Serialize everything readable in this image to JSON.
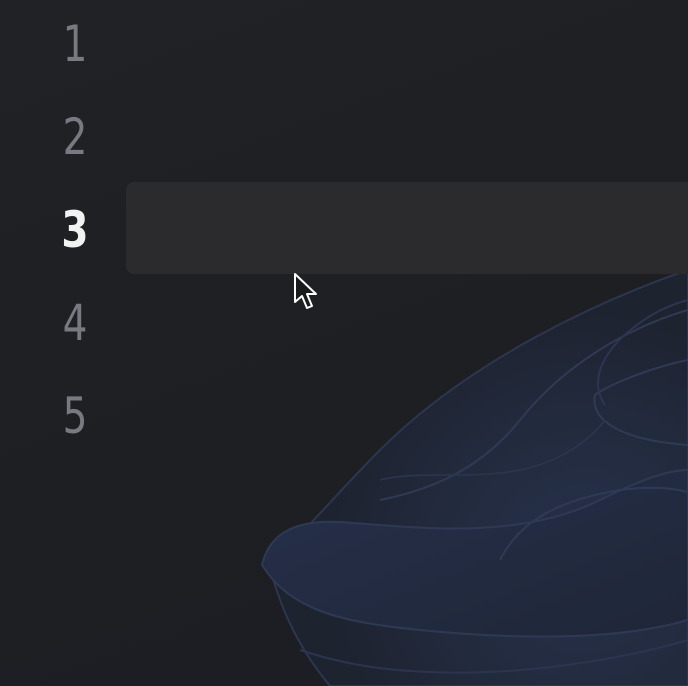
{
  "desktop": {
    "wallpaper_icon": "windows-11-bloom-wallpaper",
    "background_color": "#1e2024"
  },
  "switcher": {
    "selected_index": 3,
    "items": [
      {
        "label": "1"
      },
      {
        "label": "2"
      },
      {
        "label": "3"
      },
      {
        "label": "4"
      },
      {
        "label": "5"
      }
    ],
    "active_color": "#f2f2f2",
    "inactive_color": "#777a80",
    "highlight_color": "#2b2b2d"
  },
  "pointer": {
    "icon": "mouse-pointer-icon"
  }
}
